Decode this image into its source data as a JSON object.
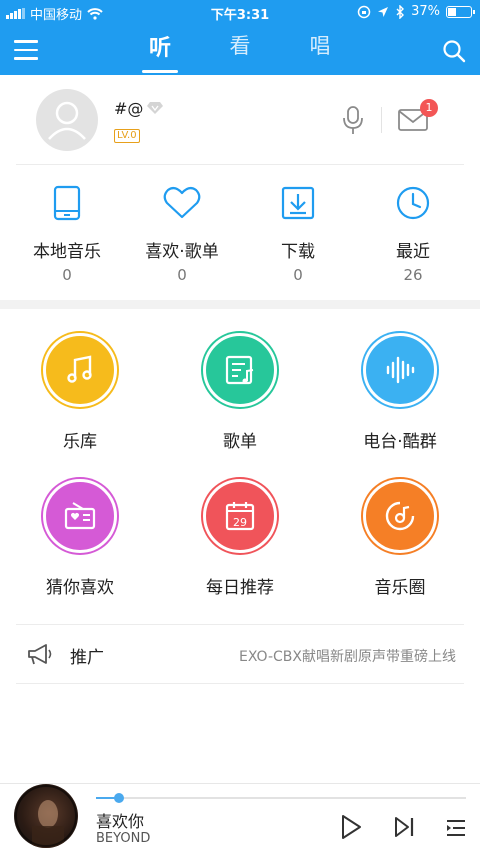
{
  "status_bar": {
    "carrier": "中国移动",
    "time": "下午3:31",
    "battery_percent": "37%",
    "battery_level": 0.37
  },
  "header": {
    "tabs": [
      {
        "label": "听",
        "active": true
      },
      {
        "label": "看",
        "active": false
      },
      {
        "label": "唱",
        "active": false
      }
    ],
    "accent_color": "#1f9cf0"
  },
  "profile": {
    "username": "#@",
    "level": "LV.0",
    "mail_badge": "1"
  },
  "quick_stats": [
    {
      "icon": "phone-icon",
      "label": "本地音乐",
      "count": "0"
    },
    {
      "icon": "heart-icon",
      "label": "喜欢·歌单",
      "count": "0"
    },
    {
      "icon": "download-icon",
      "label": "下载",
      "count": "0"
    },
    {
      "icon": "clock-icon",
      "label": "最近",
      "count": "26"
    }
  ],
  "grid": [
    {
      "icon": "music-note-icon",
      "label": "乐库",
      "color": "#f6bb1c"
    },
    {
      "icon": "playlist-icon",
      "label": "歌单",
      "color": "#27c79a"
    },
    {
      "icon": "radio-wave-icon",
      "label": "电台·酷群",
      "color": "#3bb1f2"
    },
    {
      "icon": "radio-heart-icon",
      "label": "猜你喜欢",
      "color": "#d55ad6"
    },
    {
      "icon": "calendar-icon",
      "label": "每日推荐",
      "color": "#f0545a",
      "icon_text": "29"
    },
    {
      "icon": "disc-icon",
      "label": "音乐圈",
      "color": "#f57f26"
    }
  ],
  "promo": {
    "label": "推广",
    "text": "EXO-CBX献唱新剧原声带重磅上线"
  },
  "player": {
    "song": "喜欢你",
    "artist": "BEYOND",
    "progress": 0.03
  }
}
